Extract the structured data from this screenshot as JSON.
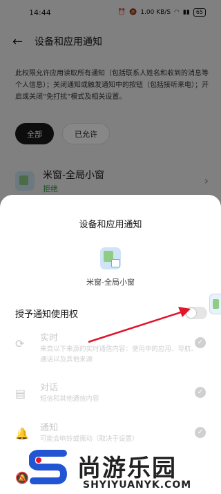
{
  "status_bar": {
    "time": "14:44",
    "net_speed": "1.00 KB/S",
    "battery": "65"
  },
  "header": {
    "title": "设备和应用通知"
  },
  "description": "此权限允许应用读取所有通知（包括联系人姓名和收到的消息等个人信息）；关闭通知或触发通知中的按钮（包括接听来电）；开启或关闭“免打扰”模式及相关设置。",
  "filters": [
    "全部",
    "已允许"
  ],
  "app_row": {
    "name": "米窗-全局小窗",
    "status": "拒绝"
  },
  "sheet": {
    "title": "设备和应用通知",
    "app_name": "米窗-全局小窗",
    "grant_label": "授予通知使用权",
    "grant_enabled": false,
    "permissions": [
      {
        "title": "实时",
        "desc": "来自以下来源的实时通信内容：使用中的应用、导航、通话以及其他来源",
        "icon": "sync-icon"
      },
      {
        "title": "对话",
        "desc": "短信和其他通信内容",
        "icon": "message-icon"
      },
      {
        "title": "通知",
        "desc": "可能会响铃或振动（取决于设置）",
        "icon": "bell-icon"
      },
      {
        "title": "",
        "desc": "",
        "icon": "bell-off-icon"
      }
    ]
  },
  "watermark": {
    "text": "尚游乐园",
    "url": "SHYIYUANYK.COM"
  },
  "colors": {
    "accent_green": "#2ea043",
    "annotation_arrow": "#e0142d"
  }
}
